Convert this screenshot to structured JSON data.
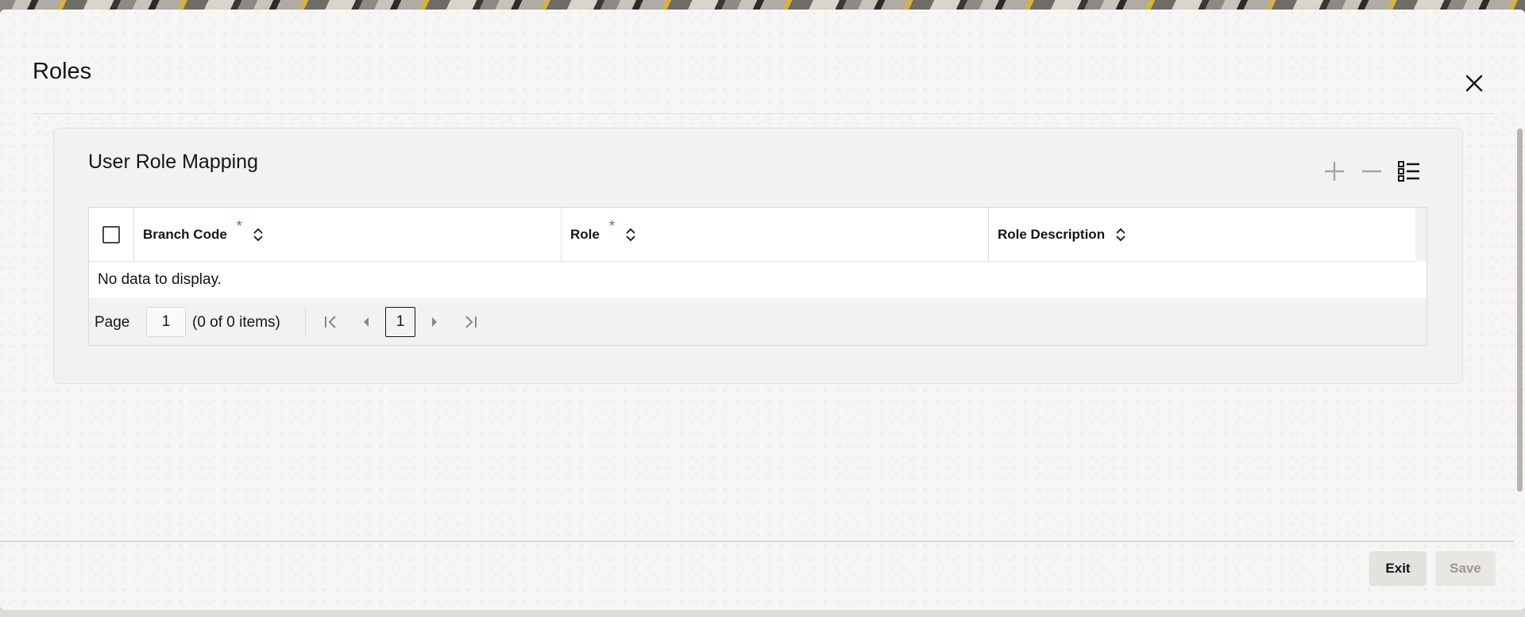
{
  "dialog": {
    "title": "Roles",
    "close_icon": "close-icon"
  },
  "section": {
    "title": "User Role Mapping",
    "toolbar": {
      "add_icon": "plus-icon",
      "remove_icon": "minus-icon",
      "detail_icon": "list-detail-icon"
    }
  },
  "grid": {
    "columns": [
      {
        "label": "Branch Code",
        "required": true,
        "required_mark": "*"
      },
      {
        "label": "Role",
        "required": true,
        "required_mark": "*"
      },
      {
        "label": "Role Description",
        "required": false
      }
    ],
    "empty_message": "No data to display."
  },
  "pager": {
    "label": "Page",
    "page_value": "1",
    "count_text": "(0 of 0 items)",
    "current_page": "1"
  },
  "footer": {
    "exit_label": "Exit",
    "save_label": "Save"
  },
  "colors": {
    "required": "#c74634",
    "text": "#161513",
    "disabled_text": "#9b9893"
  }
}
